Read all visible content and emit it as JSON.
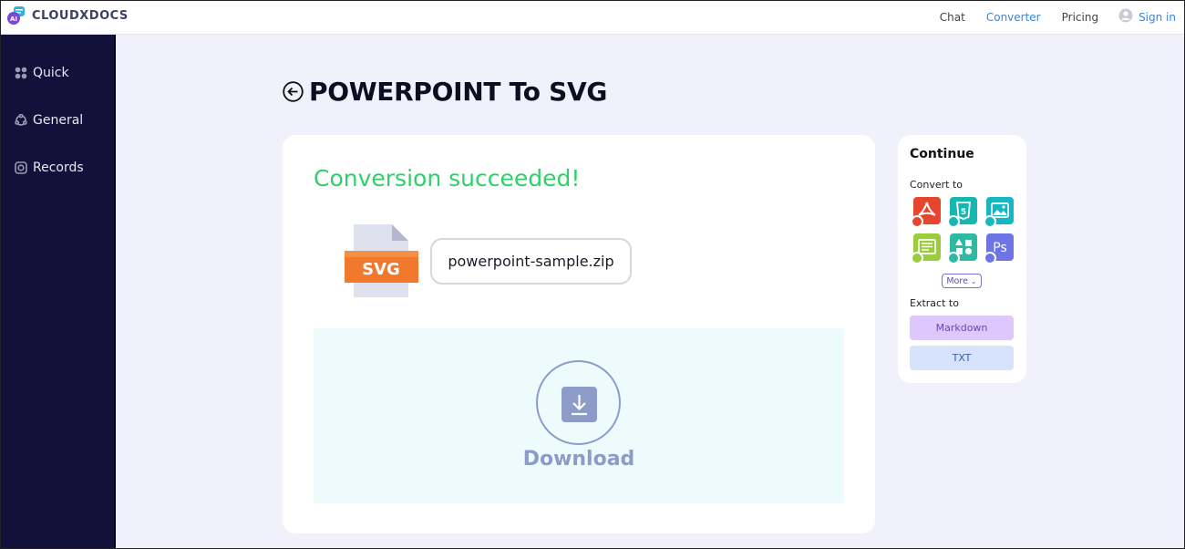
{
  "app": {
    "brand": "CLOUDXDOCS"
  },
  "nav": {
    "chat": "Chat",
    "converter": "Converter",
    "pricing": "Pricing",
    "signin": "Sign in"
  },
  "sidebar": {
    "items": [
      {
        "label": "Quick",
        "icon": "grid-icon"
      },
      {
        "label": "General",
        "icon": "cycle-icon"
      },
      {
        "label": "Records",
        "icon": "record-icon"
      }
    ]
  },
  "page": {
    "title": "POWERPOINT To SVG"
  },
  "result": {
    "status": "Conversion succeeded!",
    "file_type": "SVG",
    "file_name": "powerpoint-sample.zip",
    "download_label": "Download"
  },
  "continue_panel": {
    "title": "Continue",
    "convert_to_label": "Convert to",
    "formats": [
      {
        "icon": "pdf-icon",
        "color": "#e8452f"
      },
      {
        "icon": "html5-icon",
        "color": "#14b8b0"
      },
      {
        "icon": "image-icon",
        "color": "#14b8c4"
      },
      {
        "icon": "document-icon",
        "color": "#9bcc3c"
      },
      {
        "icon": "shapes-icon",
        "color": "#2fb8a2"
      },
      {
        "icon": "photoshop-icon",
        "color": "#6c74e6"
      }
    ],
    "more_label": "More",
    "extract_to_label": "Extract to",
    "extract_options": [
      {
        "label": "Markdown",
        "bg": "#dcc8fa",
        "color": "#6a47b8"
      },
      {
        "label": "TXT",
        "bg": "#d7e2fb",
        "color": "#3b5fb0"
      }
    ]
  },
  "colors": {
    "success": "#2fd06a",
    "accent": "#3d84d6",
    "sidebar": "#13103a",
    "download": "#8d9bc9"
  }
}
